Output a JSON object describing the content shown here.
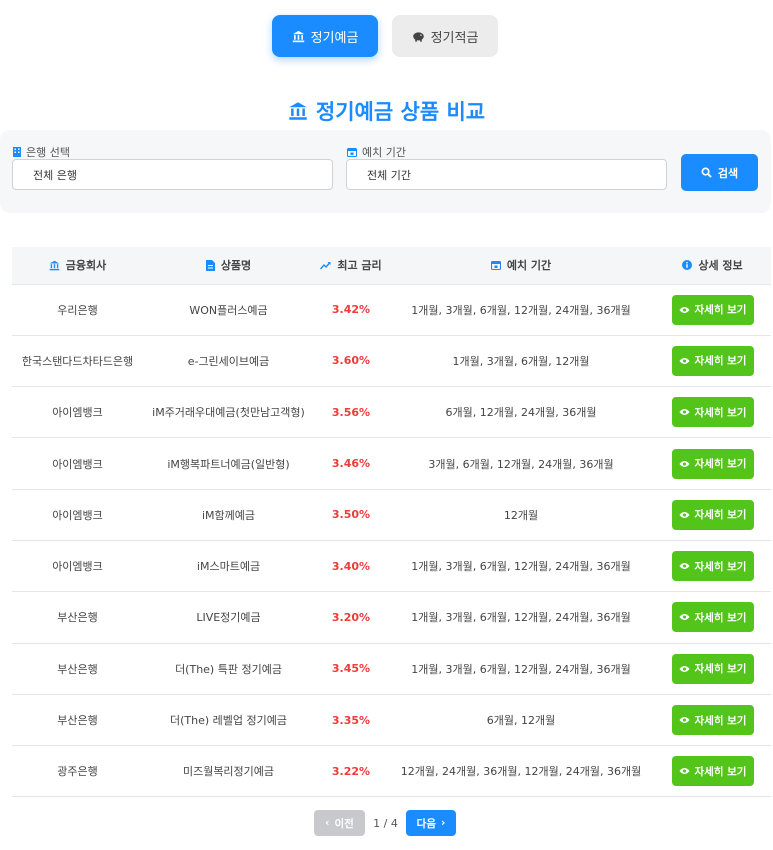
{
  "tabs": [
    {
      "label": "정기예금",
      "icon": "bank-icon",
      "active": true
    },
    {
      "label": "정기적금",
      "icon": "piggy-bank-icon",
      "active": false
    }
  ],
  "page_title": "정기예금 상품 비교",
  "filters": {
    "bank": {
      "label": "은행 선택",
      "value": "전체 은행",
      "icon": "building-icon"
    },
    "period": {
      "label": "예치 기간",
      "value": "전체 기간",
      "icon": "calendar-icon"
    },
    "search_label": "검색"
  },
  "table": {
    "headers": [
      "금융회사",
      "상품명",
      "최고 금리",
      "예치 기간",
      "상세 정보"
    ],
    "detail_label": "자세히 보기",
    "rows": [
      {
        "bank": "우리은행",
        "product": "WON플러스예금",
        "rate": "3.42%",
        "period": "1개월, 3개월, 6개월, 12개월, 24개월, 36개월"
      },
      {
        "bank": "한국스탠다드차타드은행",
        "product": "e-그린세이브예금",
        "rate": "3.60%",
        "period": "1개월, 3개월, 6개월, 12개월"
      },
      {
        "bank": "아이엠뱅크",
        "product": "iM주거래우대예금(첫만남고객형)",
        "rate": "3.56%",
        "period": "6개월, 12개월, 24개월, 36개월"
      },
      {
        "bank": "아이엠뱅크",
        "product": "iM행복파트너예금(일반형)",
        "rate": "3.46%",
        "period": "3개월, 6개월, 12개월, 24개월, 36개월"
      },
      {
        "bank": "아이엠뱅크",
        "product": "iM함께예금",
        "rate": "3.50%",
        "period": "12개월"
      },
      {
        "bank": "아이엠뱅크",
        "product": "iM스마트예금",
        "rate": "3.40%",
        "period": "1개월, 3개월, 6개월, 12개월, 24개월, 36개월"
      },
      {
        "bank": "부산은행",
        "product": "LIVE정기예금",
        "rate": "3.20%",
        "period": "1개월, 3개월, 6개월, 12개월, 24개월, 36개월"
      },
      {
        "bank": "부산은행",
        "product": "더(The) 특판 정기예금",
        "rate": "3.45%",
        "period": "1개월, 3개월, 6개월, 12개월, 24개월, 36개월"
      },
      {
        "bank": "부산은행",
        "product": "더(The) 레벨업 정기예금",
        "rate": "3.35%",
        "period": "6개월, 12개월"
      },
      {
        "bank": "광주은행",
        "product": "미즈월복리정기예금",
        "rate": "3.22%",
        "period": "12개월, 24개월, 36개월, 12개월, 24개월, 36개월"
      }
    ]
  },
  "pagination": {
    "prev_label": "이전",
    "next_label": "다음",
    "info": "1 / 4"
  },
  "colors": {
    "accent": "#1a8cff",
    "rate": "#ee3b3b",
    "detail_button": "#52c41a"
  }
}
